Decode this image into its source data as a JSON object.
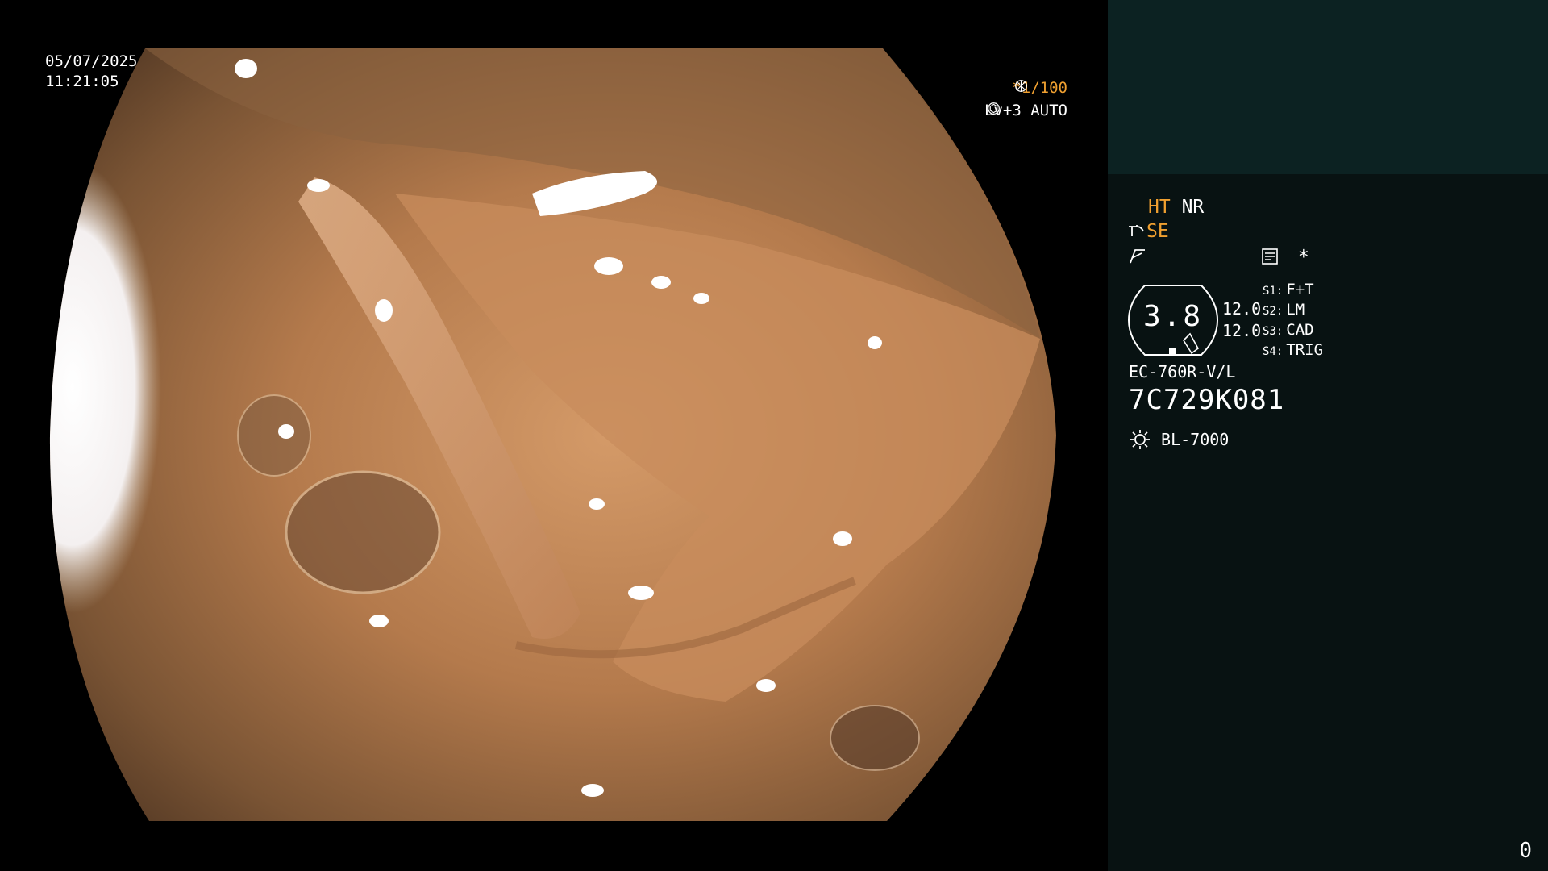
{
  "view": {
    "date": "05/07/2025",
    "time": "11:21:05",
    "exposure": "*1/100",
    "level": "Lv+3 AUTO"
  },
  "panel": {
    "ht": "HT",
    "nr": "NR",
    "se": "SE",
    "asterisk": "*",
    "gauge_value": "3.8",
    "scale_top": "12.0",
    "scale_bottom": "12.0",
    "slots": [
      {
        "label": "S1:",
        "value": "F+T"
      },
      {
        "label": "S2:",
        "value": "LM"
      },
      {
        "label": "S3:",
        "value": "CAD"
      },
      {
        "label": "S4:",
        "value": "TRIG"
      }
    ],
    "scope_model": "EC-760R-V/L",
    "scope_serial": "7C729K081",
    "light_source": "BL-7000",
    "counter": "0"
  },
  "icons": {
    "shutter": "aperture-icon",
    "auto": "iris-icon",
    "tool": "scope-tool-icon",
    "flash": "flash-icon",
    "memo": "memo-icon",
    "light": "lamp-icon"
  },
  "colors": {
    "accent": "#f0a030",
    "panel_top": "#0c2222",
    "panel": "#081212"
  }
}
